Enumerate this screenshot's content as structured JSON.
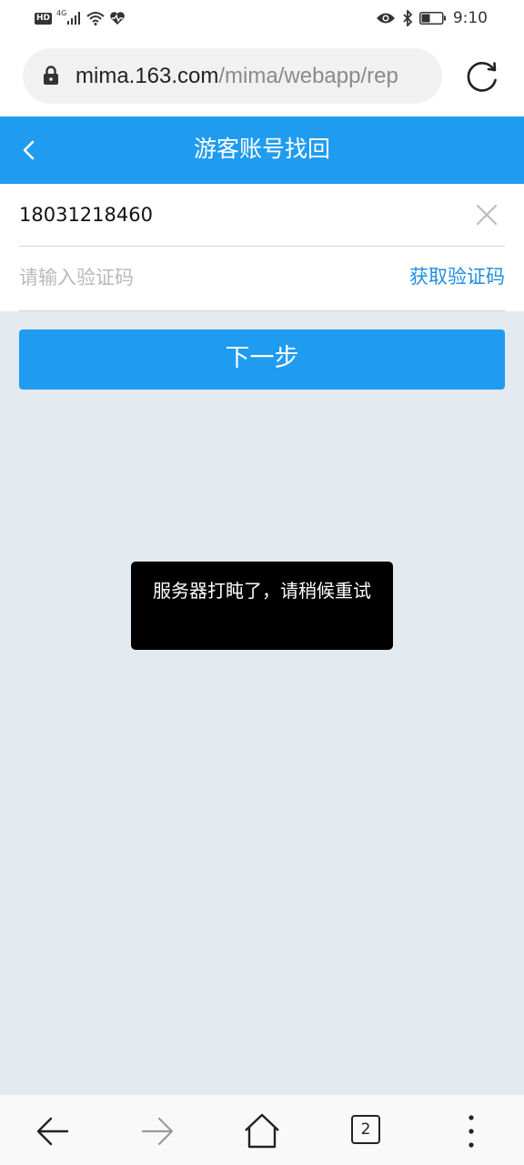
{
  "status_bar": {
    "hd_label": "HD",
    "network": "4G",
    "time": "9:10"
  },
  "url_bar": {
    "domain": "mima.163.com",
    "path": "/mima/webapp/rep"
  },
  "header": {
    "title": "游客账号找回"
  },
  "form": {
    "phone_value": "18031218460",
    "code_placeholder": "请输入验证码",
    "get_code_label": "获取验证码"
  },
  "next_button_label": "下一步",
  "toast": {
    "message": "服务器打盹了，请稍候重试"
  },
  "bottom_nav": {
    "tab_count": "2"
  },
  "colors": {
    "accent": "#1f9cf0",
    "link": "#1f8fe0",
    "background": "#e3eaef"
  },
  "icons": [
    "lock-icon",
    "reload-icon",
    "back-icon",
    "clear-icon",
    "back-arrow-icon",
    "forward-arrow-icon",
    "home-icon",
    "tabs-icon",
    "more-icon"
  ]
}
